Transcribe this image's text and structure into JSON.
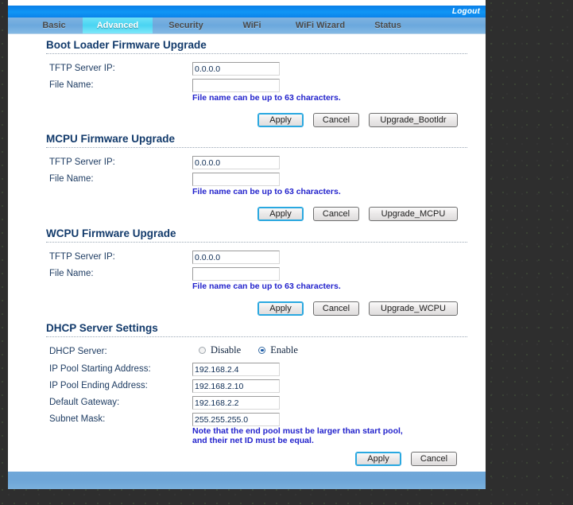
{
  "header": {
    "logout_label": "Logout"
  },
  "tabs": [
    {
      "id": "basic",
      "label": "Basic",
      "active": false
    },
    {
      "id": "advanced",
      "label": "Advanced",
      "active": true
    },
    {
      "id": "security",
      "label": "Security",
      "active": false
    },
    {
      "id": "wifi",
      "label": "WiFi",
      "active": false
    },
    {
      "id": "wifi_wizard",
      "label": "WiFi Wizard",
      "active": false
    },
    {
      "id": "status",
      "label": "Status",
      "active": false
    }
  ],
  "colors": {
    "accent_blue": "#0f96f5",
    "tab_active": "#49d4f2",
    "tab_bar": "#6ba8dd",
    "heading": "#123a6b",
    "hint_text": "#2222cc",
    "footer": "#6ea6d8"
  },
  "sections": {
    "bootloader": {
      "title": "Boot Loader Firmware Upgrade",
      "tftp_label": "TFTP Server IP:",
      "tftp_value": "0.0.0.0",
      "filename_label": "File Name:",
      "filename_value": "",
      "hint": "File name can be up to 63 characters.",
      "apply_label": "Apply",
      "cancel_label": "Cancel",
      "upgrade_label": "Upgrade_Bootldr"
    },
    "mcpu": {
      "title": "MCPU Firmware Upgrade",
      "tftp_label": "TFTP Server IP:",
      "tftp_value": "0.0.0.0",
      "filename_label": "File Name:",
      "filename_value": "",
      "hint": "File name can be up to 63 characters.",
      "apply_label": "Apply",
      "cancel_label": "Cancel",
      "upgrade_label": "Upgrade_MCPU"
    },
    "wcpu": {
      "title": "WCPU Firmware Upgrade",
      "tftp_label": "TFTP Server IP:",
      "tftp_value": "0.0.0.0",
      "filename_label": "File Name:",
      "filename_value": "",
      "hint": "File name can be up to 63 characters.",
      "apply_label": "Apply",
      "cancel_label": "Cancel",
      "upgrade_label": "Upgrade_WCPU"
    },
    "dhcp": {
      "title": "DHCP Server Settings",
      "server_label": "DHCP Server:",
      "disable_label": "Disable",
      "enable_label": "Enable",
      "selected_mode": "Enable",
      "pool_start_label": "IP Pool Starting Address:",
      "pool_start_value": "192.168.2.4",
      "pool_end_label": "IP Pool Ending Address:",
      "pool_end_value": "192.168.2.10",
      "gateway_label": "Default Gateway:",
      "gateway_value": "192.168.2.2",
      "subnet_label": "Subnet Mask:",
      "subnet_value": "255.255.255.0",
      "note_line1": "Note that the end pool must be larger than start pool,",
      "note_line2": "and their net ID must be equal.",
      "apply_label": "Apply",
      "cancel_label": "Cancel"
    }
  }
}
